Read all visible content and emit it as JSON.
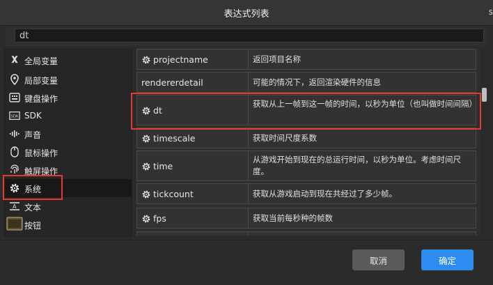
{
  "dialog": {
    "title": "表达式列表",
    "edge_char": "s"
  },
  "search": {
    "value": "dt"
  },
  "categories": [
    {
      "label": "全局变量",
      "icon": "x"
    },
    {
      "label": "局部变量",
      "icon": "pin"
    },
    {
      "label": "键盘操作",
      "icon": "keyboard"
    },
    {
      "label": "SDK",
      "icon": "sdk"
    },
    {
      "label": "声音",
      "icon": "sound-wave"
    },
    {
      "label": "鼠标操作",
      "icon": "mouse"
    },
    {
      "label": "触屏操作",
      "icon": "fingerprint"
    },
    {
      "label": "系统",
      "icon": "gear",
      "selected": true
    },
    {
      "label": "文本",
      "icon": "text"
    },
    {
      "label": "按钮",
      "icon": "button"
    }
  ],
  "expressions": [
    {
      "name": "projectname",
      "desc": "返回项目名称"
    },
    {
      "name": "rendererdetail",
      "desc": "可能的情况下，返回渲染硬件的信息"
    },
    {
      "name": "dt",
      "desc": "获取从上一帧到这一帧的时间，以秒为单位（也叫做时间间隔）",
      "highlighted": true
    },
    {
      "name": "timescale",
      "desc": "获取时间尺度系数"
    },
    {
      "name": "time",
      "desc": "从游戏开始到现在的总运行时间，以秒为单位。考虑时间尺度。"
    },
    {
      "name": "tickcount",
      "desc": "获取从游戏启动到现在共经过了多少帧。"
    },
    {
      "name": "fps",
      "desc": "获取当前每秒种的帧数"
    }
  ],
  "buttons": {
    "cancel": "取消",
    "ok": "确定"
  },
  "colors": {
    "accent": "#2e8bf0",
    "highlight": "#e53935",
    "selected_bg": "#181818"
  }
}
